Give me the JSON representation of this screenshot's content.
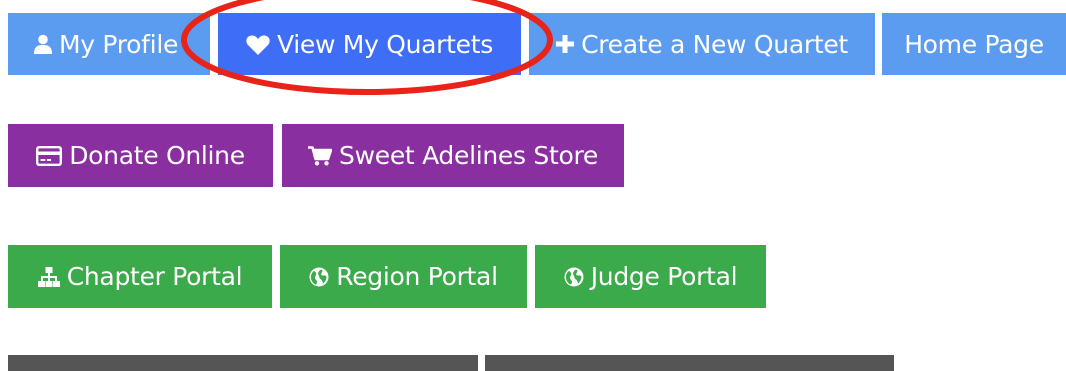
{
  "nav": {
    "my_profile": "My Profile",
    "view_quartets": "View My Quartets",
    "create_quartet": "Create a New Quartet",
    "home_page": "Home Page"
  },
  "commerce": {
    "donate": "Donate Online",
    "store": "Sweet Adelines Store"
  },
  "portals": {
    "chapter": "Chapter Portal",
    "region": "Region Portal",
    "judge": "Judge Portal"
  },
  "colors": {
    "nav_blue": "#5b9cf0",
    "nav_active": "#3e6ef5",
    "purple": "#8a2fa0",
    "green": "#3aaa4a",
    "dark": "#555555",
    "highlight_circle": "#e8241a"
  },
  "icons": {
    "my_profile": "user-icon",
    "view_quartets": "heart-icon",
    "create_quartet": "plus-icon",
    "donate": "credit-card-icon",
    "store": "shopping-cart-icon",
    "chapter": "sitemap-icon",
    "region": "globe-icon",
    "judge": "globe-icon"
  }
}
